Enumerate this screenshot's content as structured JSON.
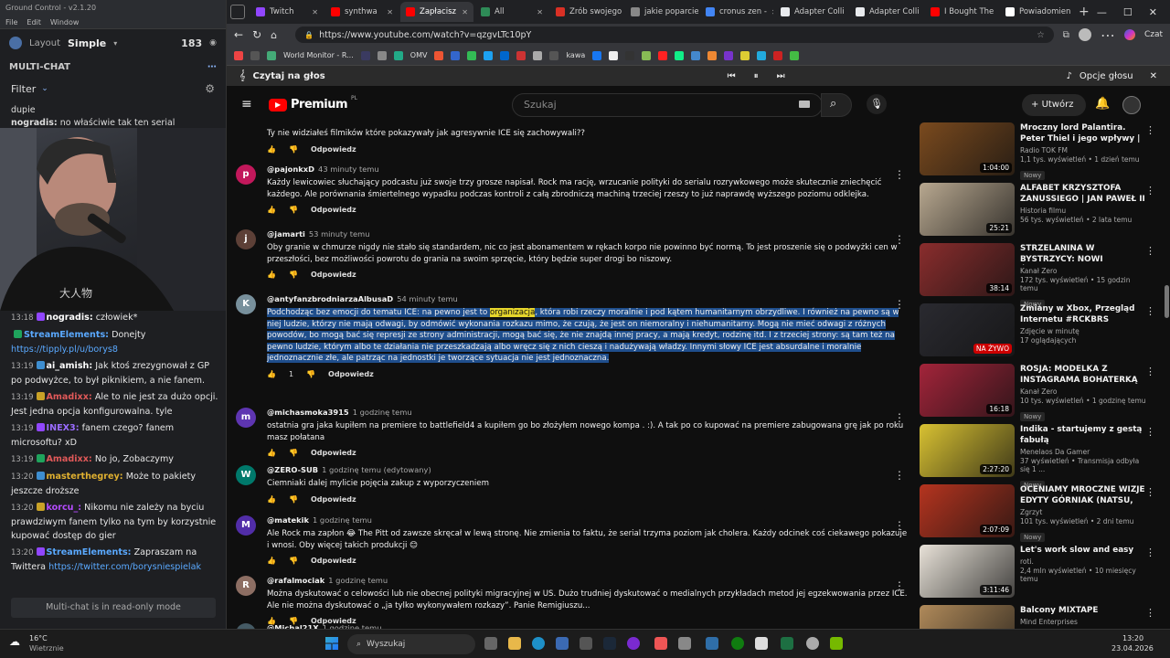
{
  "ground_control": {
    "title": "Ground Control - v2.1.20",
    "menu": [
      "File",
      "Edit",
      "Window"
    ],
    "layout_label": "Layout",
    "layout_value": "Simple",
    "viewer_count": "183",
    "multichat_label": "MULTI-CHAT",
    "filter_label": "Filter",
    "readonly_text": "Multi-chat is in read-only mode",
    "partial_top_user": "nogradis:",
    "partial_top_text": "no właściwie tak ten serial",
    "partial_top_prev": "dupie",
    "messages": [
      {
        "time": "13:18",
        "user": "nogradis:",
        "color": "#ffffff",
        "text": "człowiek*",
        "link": ""
      },
      {
        "time": "",
        "user": "StreamElements:",
        "color": "#5aa9ff",
        "text": "Donejty",
        "link": "https://tipply.pl/u/borys8"
      },
      {
        "time": "13:19",
        "user": "ai_amish:",
        "color": "#ffffff",
        "text": "Jak ktoś zrezygnował z GP po podwyżce, to był piknikiem, a nie fanem.",
        "link": ""
      },
      {
        "time": "13:19",
        "user": "Amadixx:",
        "color": "#e05959",
        "text": "Ale to nie jest za dużo opcji. Jest jedna opcja konfigurowalna. tyle",
        "link": ""
      },
      {
        "time": "13:19",
        "user": "INEX3:",
        "color": "#9a6cff",
        "text": "fanem czego? fanem microsoftu? xD",
        "link": ""
      },
      {
        "time": "13:19",
        "user": "Amadixx:",
        "color": "#e05959",
        "text": "No jo, Zobaczymy",
        "link": ""
      },
      {
        "time": "13:20",
        "user": "masterthegrey:",
        "color": "#e0b030",
        "text": "Może to pakiety jeszcze droższe",
        "link": ""
      },
      {
        "time": "13:20",
        "user": "korcu_:",
        "color": "#b54cff",
        "text": "Nikomu nie zależy na byciu prawdziwym fanem tylko na tym by korzystnie kupować dostęp do gier",
        "link": ""
      },
      {
        "time": "13:20",
        "user": "StreamElements:",
        "color": "#5aa9ff",
        "text": "Zapraszam na Twittera",
        "link": "https://twitter.com/borysniespielak"
      }
    ]
  },
  "browser": {
    "tabs": [
      {
        "label": "Twitch",
        "color": "#9146ff"
      },
      {
        "label": "synthwa",
        "color": "#ff0000"
      },
      {
        "label": "Zapłacisz",
        "color": "#ff0000"
      },
      {
        "label": "All",
        "color": "#2e8b57"
      },
      {
        "label": "Zrób swojego",
        "color": "#d93025"
      },
      {
        "label": "jakie poparcie",
        "color": "#888888"
      },
      {
        "label": "cronus zen -",
        "color": "#4285f4"
      },
      {
        "label": "Adapter Colli",
        "color": "#e8eaed"
      },
      {
        "label": "Adapter Colli",
        "color": "#e8eaed"
      },
      {
        "label": "I Bought The",
        "color": "#ff0000"
      },
      {
        "label": "Powiadomien",
        "color": "#ffffff"
      }
    ],
    "url": "https://www.youtube.com/watch?v=qzgvLTc10pY",
    "chat_button": "Czat",
    "bookmarks": [
      "World Monitor - R...",
      "OMV",
      "kawa"
    ],
    "reader_label": "Czytaj na głos",
    "voice_options": "Opcje głosu"
  },
  "youtube": {
    "logo_text": "Premium",
    "logo_region": "PL",
    "search_placeholder": "Szukaj",
    "create_label": "Utwórz",
    "reply_label": "Odpowiedz",
    "top_partial_comment": "Ty nie widziałeś filmików które pokazywały jak agresywnie ICE się zachowywali??",
    "comments": [
      {
        "author": "@pajonkxD",
        "ago": "43 minuty temu",
        "initial": "p",
        "av": "#c2185b",
        "text": "Każdy lewicowiec słuchający podcastu już swoje trzy grosze napisał. Rock ma rację, wrzucanie polityki do serialu rozrywkowego może skutecznie zniechęcić każdego. Ale porównania śmiertelnego wypadku podczas kontroli z całą zbrodniczą machiną trzeciej rzeszy to już naprawdę wyższego poziomu odklejka.",
        "likes": ""
      },
      {
        "author": "@jamarti",
        "ago": "53 minuty temu",
        "initial": "j",
        "av": "#5d4037",
        "text": "Oby granie w chmurze nigdy nie stało się standardem, nic co jest abonamentem w rękach korpo nie powinno być normą. To jest proszenie się o podwyżki cen w przeszłości, bez możliwości powrotu do grania na swoim sprzęcie, który będzie super drogi bo niszowy.",
        "likes": ""
      },
      {
        "author": "@antyfanzbrodniarzaAlbusaD",
        "ago": "54 minuty temu",
        "initial": "K",
        "av": "#78909c",
        "text_pre": "Podchodząc bez emocji do tematu ICE: na pewno jest to ",
        "text_hl": "organizacja",
        "text_post": ", która robi rzeczy moralnie i pod kątem humanitarnym obrzydliwe. I również na pewno są w niej ludzie, którzy nie mają odwagi, by odmówić wykonania rozkazu mimo, że czują, że jest on niemoralny i niehumanitarny. Mogą nie mieć odwagi z różnych powodów, bo mogą bać się represji ze strony administracji, mogą bać się, że nie znajdą innej pracy, a mają kredyt, rodzinę itd. I z trzeciej strony: są tam też na pewno ludzie, którym albo te działania nie przeszkadzają albo wręcz się z nich cieszą i nadużywają władzy. Innymi słowy ICE jest absurdalne i moralnie jednoznacznie złe, ale patrząc na jednostki je tworzące sytuacja nie jest jednoznaczna.",
        "likes": "1"
      },
      {
        "author": "@michasmoka3915",
        "ago": "1 godzinę temu",
        "initial": "m",
        "av": "#5e35b1",
        "text": "ostatnia gra jaka kupiłem na premiere to battlefield4 a kupiłem go bo złożyłem nowego kompa . :). A tak po co kupować na premiere zabugowana grę jak po roku masz połatana",
        "likes": ""
      },
      {
        "author": "@ZERO-SUB",
        "ago": "1 godzinę temu (edytowany)",
        "initial": "W",
        "av": "#00796b",
        "text": "Ciemniaki dalej mylicie pojęcia zakup z wyporzyczeniem",
        "likes": ""
      },
      {
        "author": "@matekik",
        "ago": "1 godzinę temu",
        "initial": "M",
        "av": "#512da8",
        "text": "Ale Rock ma zapłon 😂 The Pitt od zawsze skręcał w lewą stronę. Nie zmienia to faktu, że serial trzyma poziom jak cholera. Każdy odcinek coś ciekawego pokazuje i wnosi. Oby więcej takich produkcji 😊",
        "likes": ""
      },
      {
        "author": "@rafalmociak",
        "ago": "1 godzinę temu",
        "initial": "R",
        "av": "#8d6e63",
        "text": "Można dyskutować o celowości lub nie obecnej polityki migracyjnej w US. Dużo  trudniej dyskutować o medialnych przykładach metod jej egzekwowania przez ICE. Ale nie można dyskutować o „ja tylko wykonywałem rozkazy”. Panie Remigiuszu...",
        "likes": ""
      },
      {
        "author": "@Michal21X",
        "ago": "1 godzinę temu",
        "initial": "M",
        "av": "#455a64",
        "text": "",
        "likes": ""
      }
    ],
    "recommendations": [
      {
        "title": "Mroczny lord Palantira. Peter Thiel i jego wpływy | Techstorie",
        "channel": "Radio TOK FM",
        "meta": "1,1 tys. wyświetleń • 1 dzień temu",
        "badge": "Nowy",
        "duration": "1:04:00",
        "thumb": "#7a4a1e",
        "live": false
      },
      {
        "title": "ALFABET KRZYSZTOFA ZANUSSIEGO | JAN PAWEŁ II | ...",
        "channel": "Historia filmu",
        "meta": "56 tys. wyświetleń • 2 lata temu",
        "badge": "",
        "duration": "25:21",
        "thumb": "#b8a890",
        "live": false
      },
      {
        "title": "STRZELANINA W BYSTRZYCY: NOWI ŚWIADKOWIE. CO WIE ...",
        "channel": "Kanał Zero",
        "meta": "172 tys. wyświetleń • 15 godzin temu",
        "badge": "Nowy",
        "duration": "38:14",
        "thumb": "#8a2d2d",
        "live": false
      },
      {
        "title": "Zmiany w Xbox, Przegląd Internetu #RCKBRS",
        "channel": "Zdjęcie w minutę",
        "meta": "17 oglądających",
        "badge": "",
        "duration": "NA ŻYWO",
        "thumb": "#2a2a30",
        "live": true
      },
      {
        "title": "ROSJA: MODELKA Z INSTAGRAMA BOHATERKĄ ...",
        "channel": "Kanał Zero",
        "meta": "10 tys. wyświetleń • 1 godzinę temu",
        "badge": "Nowy",
        "duration": "16:18",
        "thumb": "#a3243a",
        "live": false
      },
      {
        "title": "Indika - startujemy z gestą fabułą",
        "channel": "Menelaos Da Gamer",
        "meta": "37 wyświetleń • Transmisja odbyła się 1 ...",
        "badge": "Nowy",
        "duration": "2:27:20",
        "thumb": "#d9c232",
        "live": false
      },
      {
        "title": "OCENIAMY MROCZNE WIZJE EDYTY GÓRNIAK (NATSU, TAC...",
        "channel": "Zgrzyt",
        "meta": "101 tys. wyświetleń • 2 dni temu",
        "badge": "Nowy",
        "duration": "2:07:09",
        "thumb": "#b5341f",
        "live": false
      },
      {
        "title": "Let's work slow and easy",
        "channel": "roti.",
        "meta": "2,4 mln wyświetleń • 10 miesięcy temu",
        "badge": "",
        "duration": "3:11:46",
        "thumb": "#e8e2d8",
        "live": false
      },
      {
        "title": "Balcony MIXTAPE",
        "channel": "Mind Enterprises",
        "meta": "",
        "badge": "",
        "duration": "",
        "thumb": "#b08a5a",
        "live": false
      }
    ]
  },
  "taskbar": {
    "weather_temp": "16°C",
    "weather_desc": "Wietrznie",
    "search_label": "Wyszukaj",
    "time": "13:20",
    "date": "23.04.2026"
  }
}
